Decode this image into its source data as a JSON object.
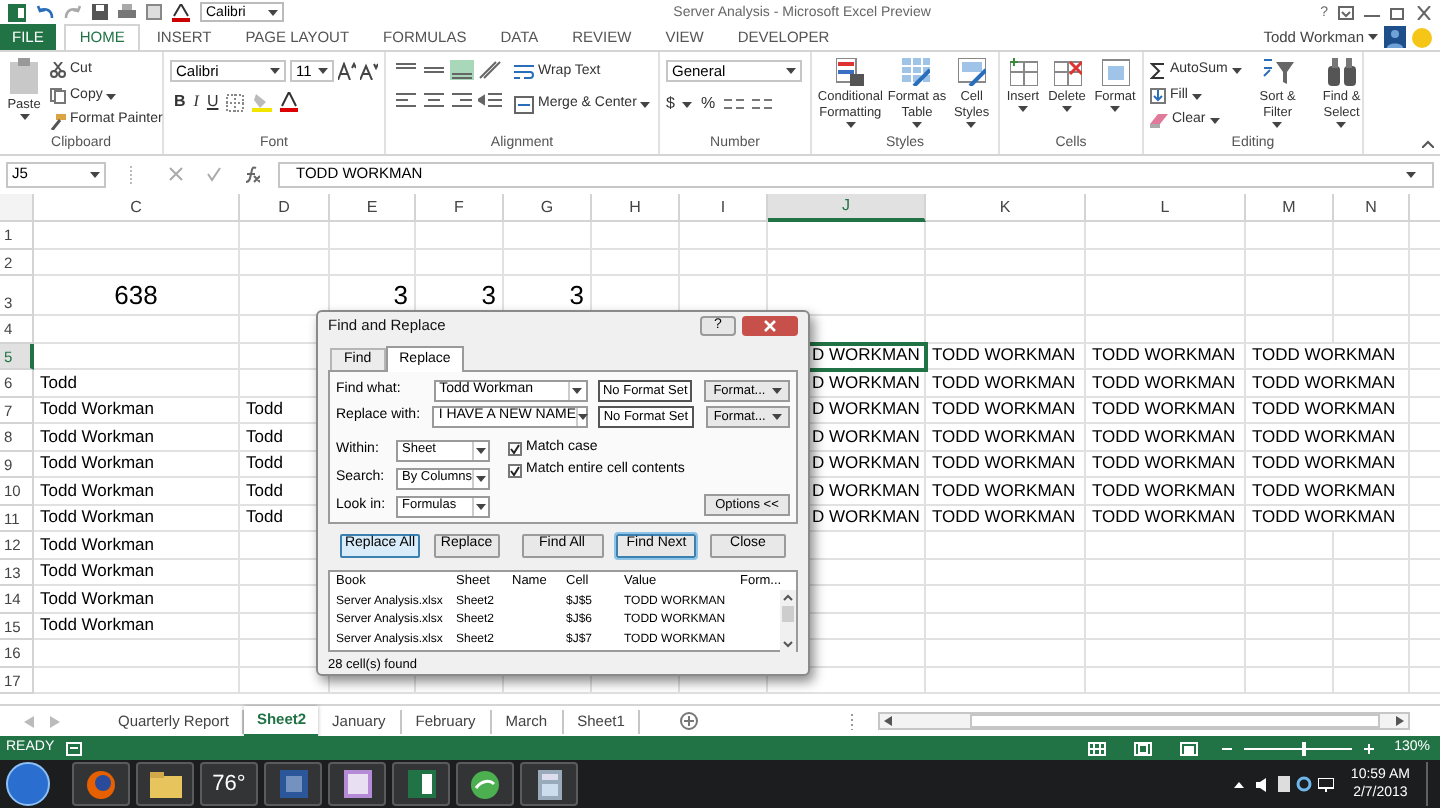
{
  "window": {
    "title": "Server Analysis - Microsoft Excel Preview",
    "quick_font": "Calibri",
    "help": "?",
    "user": "Todd Workman"
  },
  "ribbon_tabs": [
    {
      "label": "FILE",
      "kind": "file"
    },
    {
      "label": "HOME",
      "kind": "tab",
      "selected": true
    },
    {
      "label": "INSERT",
      "kind": "tab",
      "selected": false
    },
    {
      "label": "PAGE LAYOUT",
      "kind": "tab",
      "selected": false
    },
    {
      "label": "FORMULAS",
      "kind": "tab",
      "selected": false
    },
    {
      "label": "DATA",
      "kind": "tab",
      "selected": false
    },
    {
      "label": "REVIEW",
      "kind": "tab",
      "selected": false
    },
    {
      "label": "VIEW",
      "kind": "tab",
      "selected": false
    },
    {
      "label": "DEVELOPER",
      "kind": "tab",
      "selected": false
    }
  ],
  "clipboard": {
    "label": "Clipboard",
    "paste": "Paste",
    "cut": "Cut",
    "copy": "Copy",
    "format_painter": "Format Painter"
  },
  "font": {
    "label": "Font",
    "family": "Calibri",
    "size": "11",
    "bold": "B",
    "italic": "I",
    "underline": "U"
  },
  "alignment": {
    "label": "Alignment",
    "wrap": "Wrap Text",
    "merge": "Merge & Center"
  },
  "number": {
    "label": "Number",
    "format": "General",
    "currency": "$",
    "percent": "%"
  },
  "styles": {
    "label": "Styles",
    "buttons": [
      "Conditional Formatting",
      "Format as Table",
      "Cell Styles"
    ]
  },
  "cells": {
    "label": "Cells",
    "buttons": [
      "Insert",
      "Delete",
      "Format"
    ]
  },
  "editing": {
    "label": "Editing",
    "small": [
      "AutoSum",
      "Fill",
      "Clear"
    ],
    "large": [
      "Sort & Filter",
      "Find & Select"
    ]
  },
  "formula_bar": {
    "name_box": "J5",
    "formula": "TODD WORKMAN"
  },
  "sheet": {
    "columns": [
      {
        "label": "C",
        "selected": false
      },
      {
        "label": "D",
        "selected": false
      },
      {
        "label": "E",
        "selected": false
      },
      {
        "label": "F",
        "selected": false
      },
      {
        "label": "G",
        "selected": false
      },
      {
        "label": "H",
        "selected": false
      },
      {
        "label": "I",
        "selected": false
      },
      {
        "label": "J",
        "selected": true
      },
      {
        "label": "K",
        "selected": false
      },
      {
        "label": "L",
        "selected": false
      },
      {
        "label": "M",
        "selected": false
      },
      {
        "label": "N",
        "selected": false
      }
    ],
    "rows": [
      {
        "number": "1",
        "selected": false,
        "kind": "normal",
        "cells": [
          "",
          "",
          "",
          "",
          "",
          "",
          "",
          "",
          "",
          "",
          "",
          ""
        ]
      },
      {
        "number": "2",
        "selected": false,
        "kind": "normal",
        "cells": [
          "",
          "",
          "",
          "",
          "",
          "",
          "",
          "",
          "",
          "",
          "",
          ""
        ]
      },
      {
        "number": "3",
        "selected": false,
        "kind": "tall",
        "cells": [
          "638",
          "",
          "3",
          "3",
          "3",
          "",
          "",
          "",
          "",
          "",
          "",
          ""
        ]
      },
      {
        "number": "4",
        "selected": false,
        "kind": "normal",
        "cells": [
          "",
          "",
          "",
          "",
          "",
          "",
          "",
          "",
          "",
          "",
          "",
          ""
        ]
      },
      {
        "number": "5",
        "selected": true,
        "kind": "normal",
        "cells": [
          "",
          "",
          "",
          "",
          "",
          "",
          "",
          "D WORKMAN",
          "TODD WORKMAN",
          "TODD WORKMAN",
          "TODD WORKMAN",
          ""
        ]
      },
      {
        "number": "6",
        "selected": false,
        "kind": "normal",
        "cells": [
          "Todd",
          "",
          "",
          "",
          "",
          "",
          "",
          "D WORKMAN",
          "TODD WORKMAN",
          "TODD WORKMAN",
          "TODD WORKMAN",
          ""
        ]
      },
      {
        "number": "7",
        "selected": false,
        "kind": "normal",
        "cells": [
          "Todd Workman",
          "Todd",
          "",
          "",
          "",
          "",
          "",
          "D WORKMAN",
          "TODD WORKMAN",
          "TODD WORKMAN",
          "TODD WORKMAN",
          ""
        ]
      },
      {
        "number": "8",
        "selected": false,
        "kind": "normal",
        "cells": [
          "Todd Workman",
          "Todd",
          "",
          "",
          "",
          "",
          "",
          "D WORKMAN",
          "TODD WORKMAN",
          "TODD WORKMAN",
          "TODD WORKMAN",
          ""
        ]
      },
      {
        "number": "9",
        "selected": false,
        "kind": "normal",
        "cells": [
          "Todd Workman",
          "Todd",
          "",
          "",
          "",
          "",
          "",
          "D WORKMAN",
          "TODD WORKMAN",
          "TODD WORKMAN",
          "TODD WORKMAN",
          ""
        ]
      },
      {
        "number": "10",
        "selected": false,
        "kind": "normal",
        "cells": [
          "Todd Workman",
          "Todd",
          "",
          "",
          "",
          "",
          "",
          "D WORKMAN",
          "TODD WORKMAN",
          "TODD WORKMAN",
          "TODD WORKMAN",
          ""
        ]
      },
      {
        "number": "11",
        "selected": false,
        "kind": "normal",
        "cells": [
          "Todd Workman",
          "Todd",
          "",
          "",
          "",
          "",
          "",
          "D WORKMAN",
          "TODD WORKMAN",
          "TODD WORKMAN",
          "TODD WORKMAN",
          ""
        ]
      },
      {
        "number": "12",
        "selected": false,
        "kind": "normal",
        "cells": [
          "Todd Workman",
          "",
          "",
          "",
          "",
          "",
          "",
          "",
          "",
          "",
          "",
          ""
        ]
      },
      {
        "number": "13",
        "selected": false,
        "kind": "normal",
        "cells": [
          "Todd Workman",
          "",
          "",
          "",
          "",
          "",
          "",
          "",
          "",
          "",
          "",
          ""
        ]
      },
      {
        "number": "14",
        "selected": false,
        "kind": "normal",
        "cells": [
          "Todd Workman",
          "",
          "",
          "",
          "",
          "",
          "",
          "",
          "",
          "",
          "",
          ""
        ]
      },
      {
        "number": "15",
        "selected": false,
        "kind": "normal",
        "cells": [
          "Todd Workman",
          "",
          "",
          "",
          "",
          "",
          "",
          "",
          "",
          "",
          "",
          ""
        ]
      },
      {
        "number": "16",
        "selected": false,
        "kind": "normal",
        "cells": [
          "",
          "",
          "",
          "",
          "",
          "",
          "",
          "",
          "",
          "",
          "",
          ""
        ]
      },
      {
        "number": "17",
        "selected": false,
        "kind": "normal",
        "cells": [
          "",
          "",
          "",
          "",
          "",
          "",
          "",
          "",
          "",
          "",
          "",
          ""
        ]
      }
    ]
  },
  "dialog": {
    "title": "Find and Replace",
    "help": "?",
    "tabs": [
      {
        "label": "Find",
        "selected": false
      },
      {
        "label": "Replace",
        "selected": true
      }
    ],
    "fields": [
      {
        "label": "Find what:",
        "value": "Todd Workman",
        "format_state": "No Format Set",
        "format_button": "Format..."
      },
      {
        "label": "Replace with:",
        "value": "I HAVE A NEW NAME",
        "format_state": "No Format Set",
        "format_button": "Format..."
      }
    ],
    "options": [
      {
        "label": "Within:",
        "value": "Sheet"
      },
      {
        "label": "Search:",
        "value": "By Columns"
      },
      {
        "label": "Look in:",
        "value": "Formulas"
      }
    ],
    "checkboxes": [
      {
        "label": "Match case",
        "checked": true
      },
      {
        "label": "Match entire cell contents",
        "checked": true
      }
    ],
    "options_button": "Options <<",
    "buttons": [
      {
        "label": "Replace All",
        "hovered": true,
        "default": false
      },
      {
        "label": "Replace",
        "hovered": false,
        "default": false
      },
      {
        "label": "Find All",
        "hovered": false,
        "default": false
      },
      {
        "label": "Find Next",
        "hovered": false,
        "default": true
      },
      {
        "label": "Close",
        "hovered": false,
        "default": false
      }
    ],
    "results": {
      "columns": [
        "Book",
        "Sheet",
        "Name",
        "Cell",
        "Value",
        "Form..."
      ],
      "rows": [
        [
          "Server Analysis.xlsx",
          "Sheet2",
          "",
          "$J$5",
          "TODD WORKMAN",
          ""
        ],
        [
          "Server Analysis.xlsx",
          "Sheet2",
          "",
          "$J$6",
          "TODD WORKMAN",
          ""
        ],
        [
          "Server Analysis.xlsx",
          "Sheet2",
          "",
          "$J$7",
          "TODD WORKMAN",
          ""
        ]
      ]
    },
    "status": "28 cell(s) found"
  },
  "sheet_tabs": [
    {
      "label": "Quarterly Report",
      "selected": false
    },
    {
      "label": "Sheet2",
      "selected": true
    },
    {
      "label": "January",
      "selected": false
    },
    {
      "label": "February",
      "selected": false
    },
    {
      "label": "March",
      "selected": false
    },
    {
      "label": "Sheet1",
      "selected": false
    }
  ],
  "status_bar": {
    "mode": "READY",
    "zoom": {
      "level": 0.55,
      "reading": "130%"
    }
  },
  "taskbar": {
    "weather": "76°",
    "time": "10:59 AM",
    "date": "2/7/2013"
  }
}
